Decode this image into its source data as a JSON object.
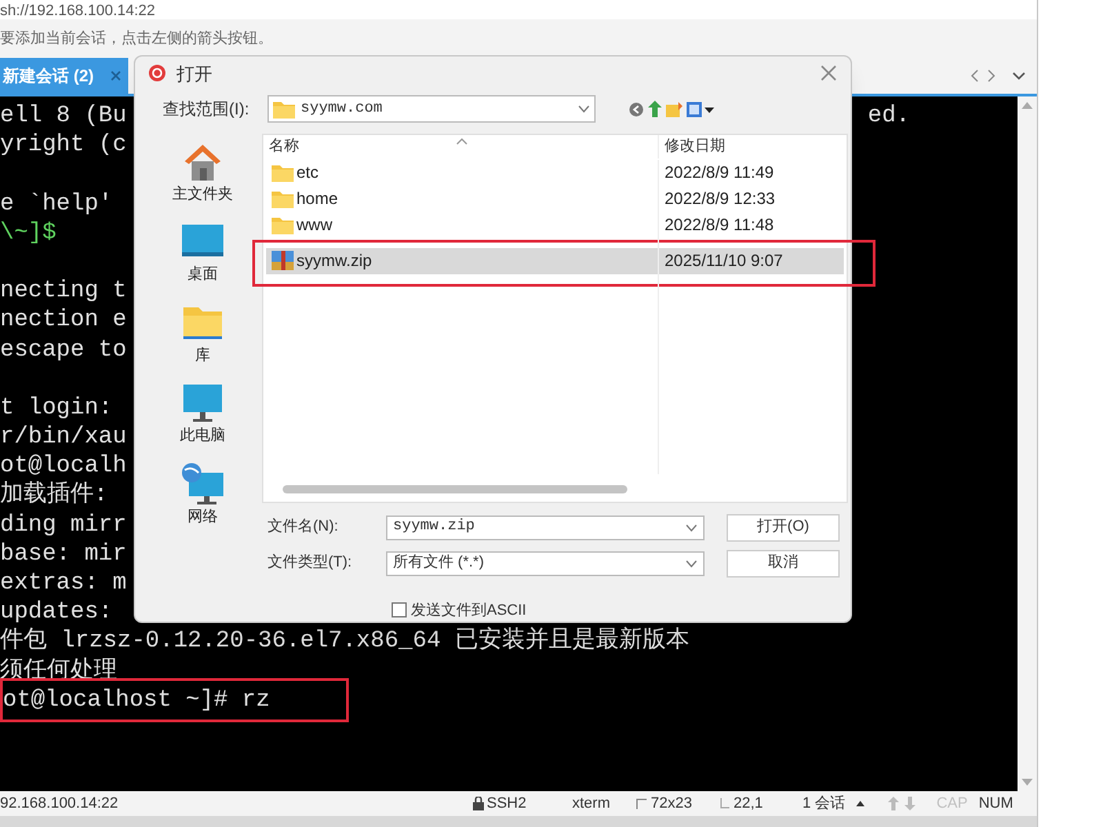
{
  "address_bar": {
    "text": "sh://192.168.100.14:22"
  },
  "hint": "要添加当前会话，点击左侧的箭头按钮。",
  "tabs": [
    {
      "label": "新建会话 (2)",
      "selected": true
    }
  ],
  "terminal": {
    "lines": [
      {
        "kind": "text",
        "text": "ell 8 (Bu",
        "tail": "ed."
      },
      {
        "kind": "text",
        "text": "yright (c"
      },
      {
        "kind": "blank"
      },
      {
        "kind": "text",
        "text": "e `help'"
      },
      {
        "kind": "prompt",
        "text": "\\~]$"
      },
      {
        "kind": "blank"
      },
      {
        "kind": "text",
        "text": "necting t"
      },
      {
        "kind": "text",
        "text": "nection e"
      },
      {
        "kind": "text",
        "text": "escape to"
      },
      {
        "kind": "blank"
      },
      {
        "kind": "text",
        "text": "t login:"
      },
      {
        "kind": "text",
        "text": "r/bin/xau"
      },
      {
        "kind": "text",
        "text": "ot@localh"
      },
      {
        "kind": "text",
        "text": "加载插件:"
      },
      {
        "kind": "text",
        "text": "ding mirr"
      },
      {
        "kind": "text",
        "text": "base: mir"
      },
      {
        "kind": "text",
        "text": "extras: m"
      },
      {
        "kind": "text",
        "text": "updates:"
      },
      {
        "kind": "text",
        "text": "件包 lrzsz-0.12.20-36.el7.x86_64 已安装并且是最新版本"
      },
      {
        "kind": "text",
        "text": "须任何处理"
      },
      {
        "kind": "text",
        "text": "ot@localhost ~]# rz",
        "highlighted": true
      }
    ]
  },
  "dialog": {
    "title": "打开",
    "look_in": {
      "label": "查找范围(I):",
      "value": "syymw.com"
    },
    "places": [
      {
        "kind": "home",
        "label": "主文件夹"
      },
      {
        "kind": "desktop",
        "label": "桌面"
      },
      {
        "kind": "library",
        "label": "库"
      },
      {
        "kind": "computer",
        "label": "此电脑"
      },
      {
        "kind": "network",
        "label": "网络"
      }
    ],
    "columns": [
      "名称",
      "修改日期"
    ],
    "files": [
      {
        "kind": "folder",
        "name": "etc",
        "modified": "2022/8/9 11:49",
        "selected": false,
        "highlighted": false
      },
      {
        "kind": "folder",
        "name": "home",
        "modified": "2022/8/9 12:33",
        "selected": false,
        "highlighted": false
      },
      {
        "kind": "folder",
        "name": "www",
        "modified": "2022/8/9 11:48",
        "selected": false,
        "highlighted": false
      },
      {
        "kind": "zip",
        "name": "syymw.zip",
        "modified": "2025/11/10 9:07",
        "selected": true,
        "highlighted": true
      }
    ],
    "file_name": {
      "label": "文件名(N):",
      "value": "syymw.zip"
    },
    "file_type": {
      "label": "文件类型(T):",
      "value": "所有文件 (*.*)"
    },
    "buttons": [
      "打开(O)",
      "取消"
    ],
    "ascii": {
      "label": "发送文件到ASCII",
      "checked": false
    }
  },
  "status_bar": {
    "address": "92.168.100.14:22",
    "protocol": "SSH2",
    "terminal_type": "xterm",
    "size": "72x23",
    "cursor": "22,1",
    "sessions": "1 会话",
    "indicators": [
      {
        "label": "CAP",
        "on": false
      },
      {
        "label": "NUM",
        "on": true
      }
    ]
  }
}
